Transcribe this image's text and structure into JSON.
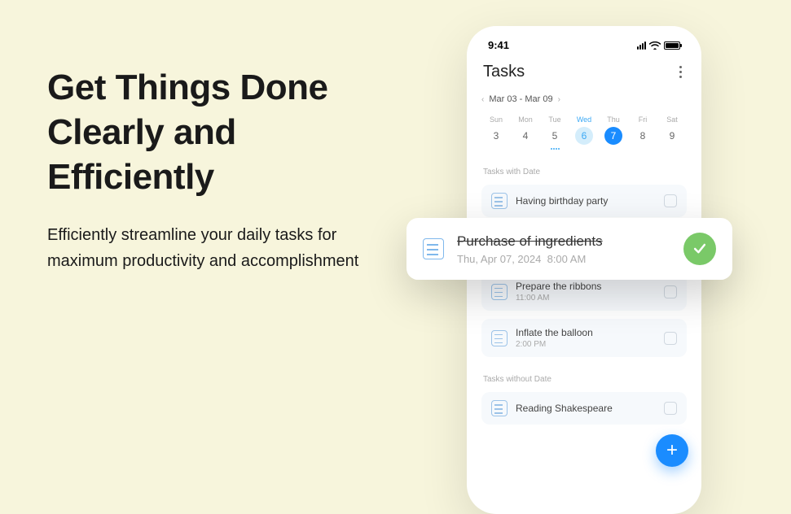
{
  "hero": {
    "headline": "Get Things Done Clearly and Efficiently",
    "sub": "Efficiently streamline your daily tasks for maximum productivity and accomplishment"
  },
  "status": {
    "time": "9:41"
  },
  "app": {
    "title": "Tasks"
  },
  "range": {
    "label": "Mar 03 - Mar 09"
  },
  "days": [
    {
      "label": "Sun",
      "num": "3"
    },
    {
      "label": "Mon",
      "num": "4"
    },
    {
      "label": "Tue",
      "num": "5"
    },
    {
      "label": "Wed",
      "num": "6"
    },
    {
      "label": "Thu",
      "num": "7"
    },
    {
      "label": "Fri",
      "num": "8"
    },
    {
      "label": "Sat",
      "num": "9"
    }
  ],
  "sections": {
    "withDate": "Tasks with Date",
    "withoutDate": "Tasks without Date"
  },
  "tasks": {
    "t1": {
      "title": "Having birthday party"
    },
    "t2": {
      "title": "Prepare the ribbons",
      "time": "11:00 AM"
    },
    "t3": {
      "title": "Inflate the balloon",
      "time": "2:00 PM"
    },
    "t4": {
      "title": "Reading Shakespeare"
    }
  },
  "popup": {
    "title": "Purchase of ingredients",
    "date": "Thu, Apr 07, 2024",
    "time": "8:00 AM"
  },
  "fab": {
    "label": "+"
  }
}
